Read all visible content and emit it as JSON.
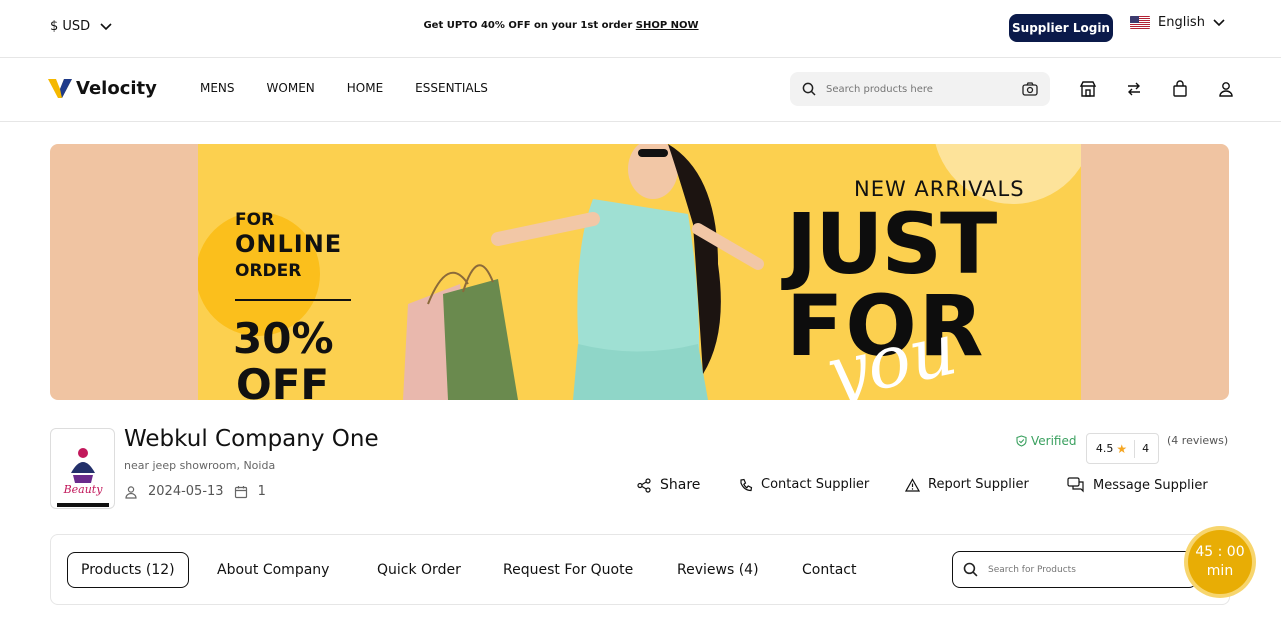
{
  "topbar": {
    "currency": "$ USD",
    "promo_text": "Get UPTO 40% OFF on your 1st order",
    "promo_link": "SHOP NOW",
    "supplier_login": "Supplier Login",
    "language": "English"
  },
  "nav": {
    "brand": "Velocity",
    "menu": [
      "MENS",
      "WOMEN",
      "HOME",
      "ESSENTIALS"
    ],
    "search_placeholder": "Search products here"
  },
  "banner": {
    "left_line1": "FOR",
    "left_line2": "ONLINE",
    "left_line3": "ORDER",
    "discount": "30%",
    "discount_suffix": "OFF",
    "new_arrivals": "NEW ARRIVALS",
    "headline1": "JUST",
    "headline2": "FOR",
    "script_word": "you"
  },
  "supplier": {
    "logo_text": "Beauty",
    "name": "Webkul Company One",
    "address": "near jeep showroom, Noida",
    "joined": "2024-05-13",
    "count": "1",
    "verified": "Verified",
    "rating": "4.5",
    "rating_count": "4",
    "reviews": "(4 reviews)",
    "actions": {
      "share": "Share",
      "contact": "Contact Supplier",
      "report": "Report Supplier",
      "message": "Message Supplier"
    }
  },
  "tabs": {
    "items": [
      "Products (12)",
      "About Company",
      "Quick Order",
      "Request For Quote",
      "Reviews (4)",
      "Contact"
    ],
    "search_placeholder": "Search for Products"
  },
  "timer": {
    "time": "45 : 00",
    "unit": "min"
  },
  "colors": {
    "brand_navy": "#0b1a4a",
    "banner_yellow": "#fcd04f",
    "banner_peach": "#f0c4a2",
    "verified_green": "#3aa05f",
    "timer_gold": "#e8ad05",
    "logo_blue": "#1e3a8a",
    "logo_yellow": "#f5b800"
  }
}
